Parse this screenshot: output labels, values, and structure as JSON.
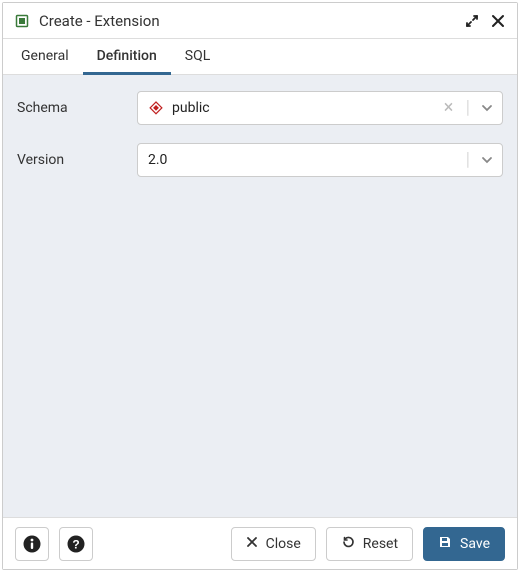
{
  "titlebar": {
    "title": "Create - Extension",
    "icon_name": "extension-icon"
  },
  "tabs": [
    {
      "label": "General",
      "active": false
    },
    {
      "label": "Definition",
      "active": true
    },
    {
      "label": "SQL",
      "active": false
    }
  ],
  "fields": {
    "schema": {
      "label": "Schema",
      "value": "public",
      "clearable": true,
      "icon_name": "diamond-schema-icon"
    },
    "version": {
      "label": "Version",
      "value": "2.0",
      "clearable": false
    }
  },
  "footer": {
    "close_label": "Close",
    "reset_label": "Reset",
    "save_label": "Save"
  },
  "colors": {
    "accent": "#336791",
    "panel_bg": "#ebeef3"
  }
}
